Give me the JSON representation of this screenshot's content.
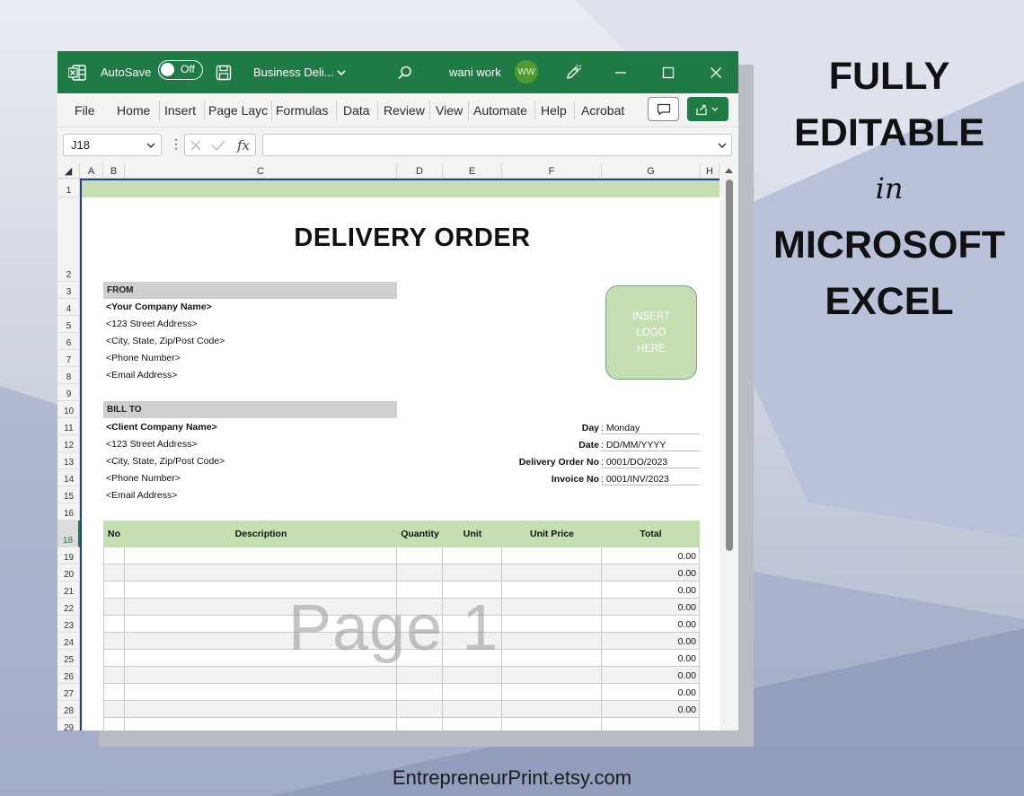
{
  "titlebar": {
    "autosave_label": "AutoSave",
    "autosave_state": "Off",
    "file_name": "Business Deli...",
    "user_name": "wani work",
    "user_initials": "WW",
    "accent_color": "#1e7b45"
  },
  "ribbon": {
    "tabs": [
      "File",
      "Home",
      "Insert",
      "Page Layc",
      "Formulas",
      "Data",
      "Review",
      "View",
      "Automate",
      "Help",
      "Acrobat"
    ]
  },
  "formula_bar": {
    "cell_reference": "J18",
    "fx_label": "fx",
    "formula_value": ""
  },
  "columns": [
    "A",
    "B",
    "C",
    "D",
    "E",
    "F",
    "G",
    "H"
  ],
  "rows": [
    "1",
    "2",
    "3",
    "4",
    "5",
    "6",
    "7",
    "8",
    "9",
    "10",
    "11",
    "12",
    "13",
    "14",
    "15",
    "16",
    "18",
    "19",
    "20",
    "21",
    "22",
    "23",
    "24",
    "25",
    "26",
    "27",
    "28",
    "29"
  ],
  "document": {
    "title": "DELIVERY ORDER",
    "from_header": "FROM",
    "from_lines": [
      "<Your Company Name>",
      "<123 Street Address>",
      "<City, State, Zip/Post Code>",
      "<Phone Number>",
      "<Email Address>"
    ],
    "bill_to_header": "BILL TO",
    "bill_to_lines": [
      "<Client Company Name>",
      "<123 Street Address>",
      "<City, State, Zip/Post Code>",
      "<Phone Number>",
      "<Email Address>"
    ],
    "logo_text": [
      "INSERT",
      "LOGO",
      "HERE"
    ],
    "meta": [
      {
        "label": "Day",
        "value": ": Monday"
      },
      {
        "label": "Date",
        "value": ": DD/MM/YYYY"
      },
      {
        "label": "Delivery Order No",
        "value": ": 0001/DO/2023"
      },
      {
        "label": "Invoice No",
        "value": ": 0001/INV/2023"
      }
    ],
    "table_headers": [
      "No",
      "Description",
      "Quantity",
      "Unit",
      "Unit Price",
      "Total"
    ],
    "row_totals": [
      "0.00",
      "0.00",
      "0.00",
      "0.00",
      "0.00",
      "0.00",
      "0.00",
      "0.00",
      "0.00",
      "0.00"
    ],
    "watermark": "Page 1",
    "header_color": "#c5dfb2"
  },
  "promo": {
    "line1": "FULLY",
    "line2": "EDITABLE",
    "line3": "in",
    "line4": "MICROSOFT",
    "line5": "EXCEL"
  },
  "footer": {
    "site": "EntrepreneurPrint.etsy.com"
  }
}
